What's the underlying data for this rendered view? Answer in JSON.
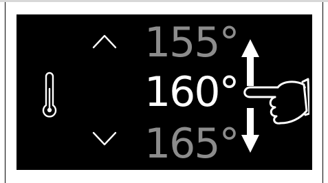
{
  "temperature_selector": {
    "previous_value": "155°",
    "current_value": "160°",
    "next_value": "165°"
  },
  "icons": {
    "thermometer": "thermometer-icon",
    "increase": "chevron-up-icon",
    "decrease": "chevron-down-icon",
    "gesture": "swipe-vertical-hand-icon"
  },
  "colors": {
    "screen_background": "#000000",
    "selected_text": "#ffffff",
    "unselected_text": "#8c8c8c"
  }
}
